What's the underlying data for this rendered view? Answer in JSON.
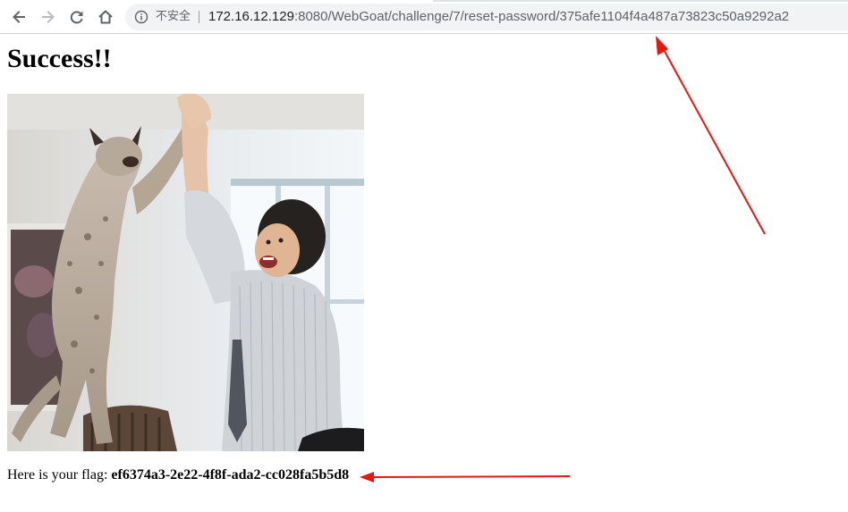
{
  "browser": {
    "nav_icons": [
      "back-arrow-icon",
      "forward-arrow-icon",
      "reload-icon",
      "home-icon"
    ],
    "security_icon": "info-icon",
    "security_text": "不安全",
    "url_host": "172.16.12.129",
    "url_rest": ":8080/WebGoat/challenge/7/reset-password/375afe1104f4a487a73823c50a9292a2"
  },
  "page": {
    "title": "Success!!",
    "flag_prefix": "Here is your flag: ",
    "flag_value": "ef6374a3-2e22-4f8f-ada2-cc028fa5b5d8"
  },
  "colors": {
    "annotation_arrow": "#e8170f",
    "omnibox_bg": "#f1f3f4",
    "icon_gray": "#5f6368"
  }
}
